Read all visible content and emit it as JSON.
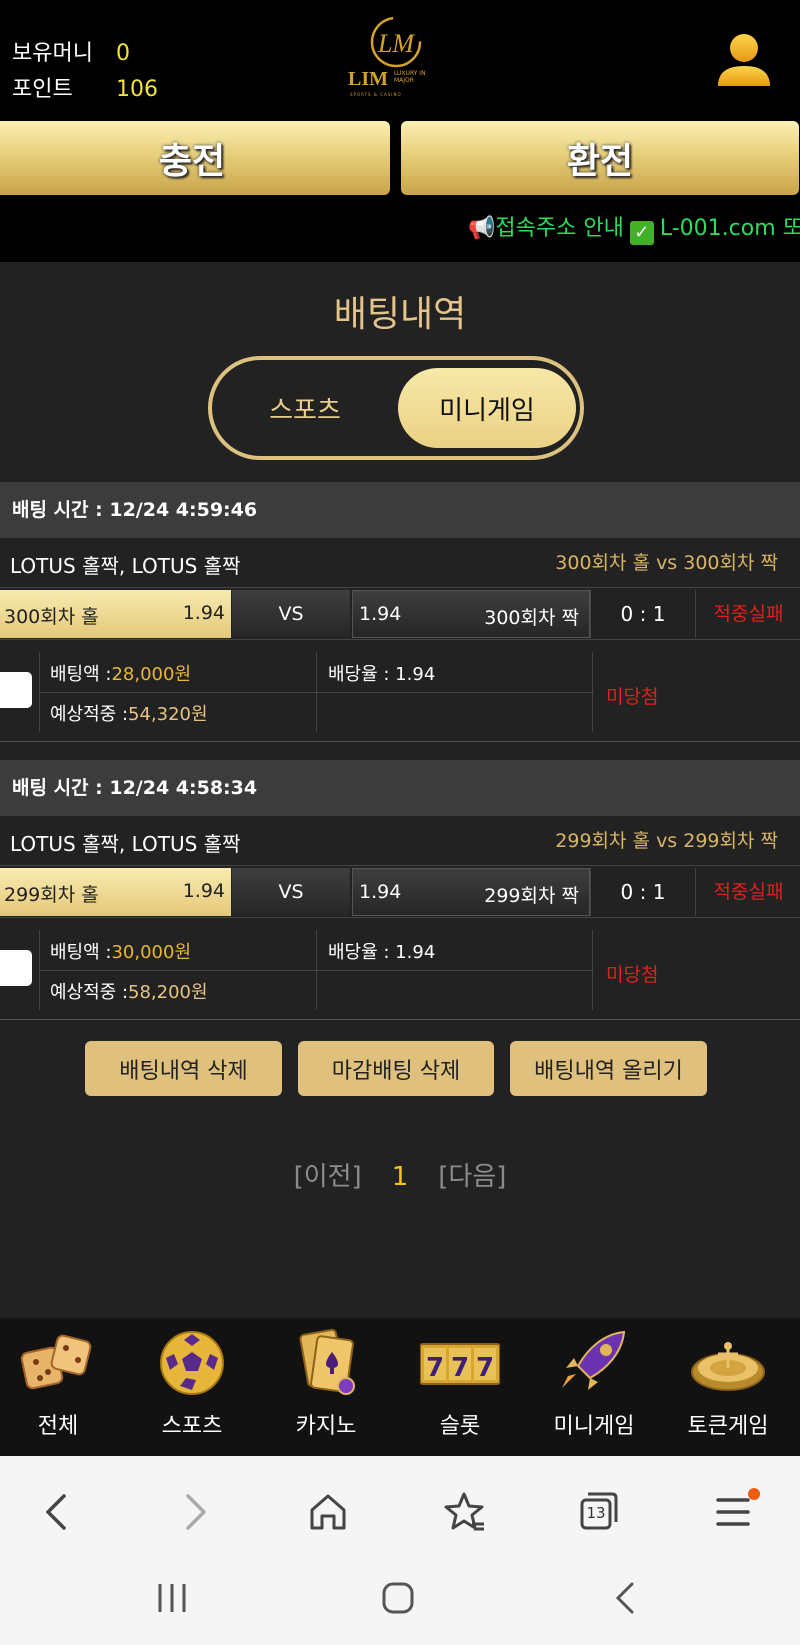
{
  "header": {
    "money_label": "보유머니",
    "money_value": "0",
    "point_label": "포인트",
    "point_value": "106",
    "logo": {
      "mark": "LM",
      "name": "LIM",
      "sub": "LUXURY IN MAJOR",
      "tagline": "SPORTS & CASINO"
    },
    "charge_label": "충전",
    "exchange_label": "환전",
    "marquee_text": "접속주소 안내",
    "marquee_url": "L-001.com 또"
  },
  "page": {
    "title": "배팅내역",
    "tabs": [
      "스포츠",
      "미니게임"
    ],
    "active_tab": "미니게임"
  },
  "bets": [
    {
      "time_label": "배팅 시간 : 12/24 4:59:46",
      "game": "LOTUS 홀짝, LOTUS 홀짝",
      "match": "300회차 홀  vs  300회차 짝",
      "home_name": "300회차 홀",
      "home_odds": "1.94",
      "vs": "VS",
      "away_odds": "1.94",
      "away_name": "300회차 짝",
      "score": "0 : 1",
      "result": "적중실패",
      "stake_label": "배팅액 :",
      "stake_value": "28,000원",
      "odds_label": "배당율 : 1.94",
      "expected_label": "예상적중 :",
      "expected_value": "54,320원",
      "status": "미당첨"
    },
    {
      "time_label": "배팅 시간 : 12/24 4:58:34",
      "game": "LOTUS 홀짝, LOTUS 홀짝",
      "match": "299회차 홀  vs  299회차 짝",
      "home_name": "299회차 홀",
      "home_odds": "1.94",
      "vs": "VS",
      "away_odds": "1.94",
      "away_name": "299회차 짝",
      "score": "0 : 1",
      "result": "적중실패",
      "stake_label": "배팅액 :",
      "stake_value": "30,000원",
      "odds_label": "배당율 : 1.94",
      "expected_label": "예상적중 :",
      "expected_value": "58,200원",
      "status": "미당첨"
    }
  ],
  "actions": [
    "배팅내역 삭제",
    "마감배팅 삭제",
    "배팅내역 올리기"
  ],
  "pager": {
    "prev": "[이전]",
    "current": "1",
    "next": "[다음]"
  },
  "game_nav": [
    {
      "label": "전체",
      "icon": "dice-icon"
    },
    {
      "label": "스포츠",
      "icon": "soccer-ball-icon"
    },
    {
      "label": "카지노",
      "icon": "playing-cards-icon"
    },
    {
      "label": "슬롯",
      "icon": "slot-777-icon"
    },
    {
      "label": "미니게임",
      "icon": "rocket-icon"
    },
    {
      "label": "토큰게임",
      "icon": "roulette-icon"
    }
  ],
  "browser": {
    "tab_count": "13"
  },
  "colors": {
    "gold": "#e4c879",
    "fail_red": "#e0201c",
    "money_yellow": "#f4e23a",
    "marquee_green": "#2ddc5a"
  }
}
